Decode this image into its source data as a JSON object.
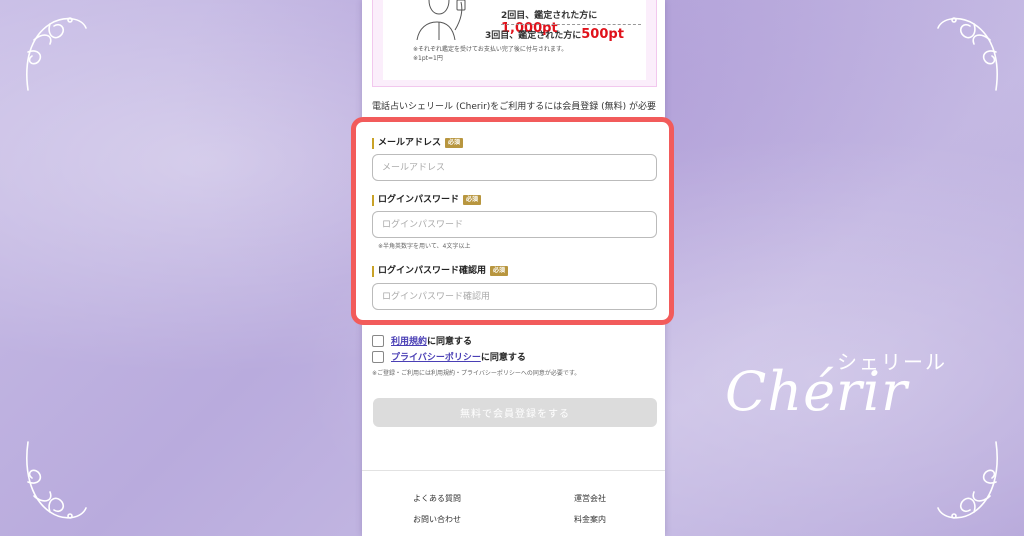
{
  "brand": {
    "script": "Chérir",
    "kana": "シェリール"
  },
  "promo": {
    "line1_prefix": "2回目、鑑定された方に",
    "line1_points": "1,000pt",
    "line2_prefix": "3回目、鑑定された方に",
    "line2_points": "500pt",
    "note1": "※それぞれ鑑定を受けてお支払い完了後に付与されます。",
    "note2": "※1pt=1円"
  },
  "intro_text": "電話占いシェリール (Cherir)をご利用するには会員登録 (無料) が必要です。",
  "form": {
    "required_badge": "必須",
    "email": {
      "label": "メールアドレス",
      "placeholder": "メールアドレス",
      "value": ""
    },
    "password": {
      "label": "ログインパスワード",
      "placeholder": "ログインパスワード",
      "value": "",
      "hint": "※半角英数字を用いて、4文字以上"
    },
    "password_confirm": {
      "label": "ログインパスワード確認用",
      "placeholder": "ログインパスワード確認用",
      "value": ""
    }
  },
  "agreements": {
    "terms_link": "利用規約",
    "terms_suffix": "に同意する",
    "privacy_link": "プライバシーポリシー",
    "privacy_suffix": "に同意する",
    "note": "※ご登録・ご利用には利用規約・プライバシーポリシーへの同意が必要です。"
  },
  "submit_label": "無料で会員登録をする",
  "footer": {
    "faq": "よくある質問",
    "company": "運営会社",
    "contact": "お問い合わせ",
    "pricing": "料金案内"
  },
  "colors": {
    "highlight_border": "#f25b5b",
    "required_badge": "#b8963f",
    "points_red": "#e0121b",
    "link": "#4a3fb5"
  }
}
